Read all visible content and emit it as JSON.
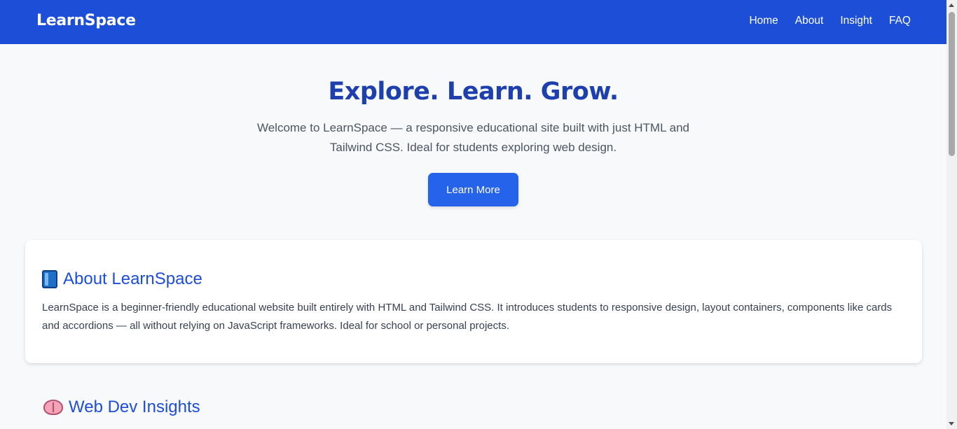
{
  "header": {
    "brand": "LearnSpace",
    "nav": [
      "Home",
      "About",
      "Insight",
      "FAQ"
    ]
  },
  "hero": {
    "title": "Explore. Learn. Grow.",
    "subtitle": "Welcome to LearnSpace — a responsive educational site built with just HTML and Tailwind CSS. Ideal for students exploring web design.",
    "cta_label": "Learn More"
  },
  "about": {
    "icon": "book-icon",
    "title": "About LearnSpace",
    "body": "LearnSpace is a beginner-friendly educational website built entirely with HTML and Tailwind CSS. It introduces students to responsive design, layout containers, components like cards and accordions — all without relying on JavaScript frameworks. Ideal for school or personal projects."
  },
  "insights": {
    "icon": "brain-icon",
    "title": "Web Dev Insights"
  },
  "colors": {
    "nav_bg": "#1d4ed8",
    "title": "#1e40af",
    "button": "#2563eb",
    "page_bg": "#f8f9fb"
  }
}
